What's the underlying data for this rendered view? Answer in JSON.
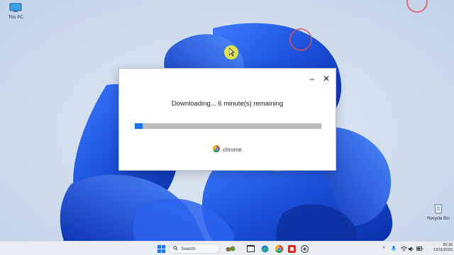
{
  "desktop": {
    "this_pc_label": "This PC",
    "recycle_bin_label": "Recycle Bin"
  },
  "dialog": {
    "minimize_glyph": "–",
    "close_glyph": "✕",
    "status_text": "Downloading... 6 minute(s) remaining",
    "progress_fraction": 0.04,
    "brand_name": "chrome"
  },
  "taskbar": {
    "search_placeholder": "Search",
    "time": "20:36",
    "date": "13/11/2023",
    "icons": [
      "start-icon",
      "search-icon",
      "widgets-icon",
      "file-explorer-icon",
      "edge-icon",
      "chrome-icon",
      "app-red-icon",
      "app-settings-icon"
    ],
    "tray_chevron": "^"
  },
  "colors": {
    "accent_blue": "#1a73e8",
    "progress_track": "#bcbcbc",
    "wallpaper_blue": "#1f4fd6"
  }
}
